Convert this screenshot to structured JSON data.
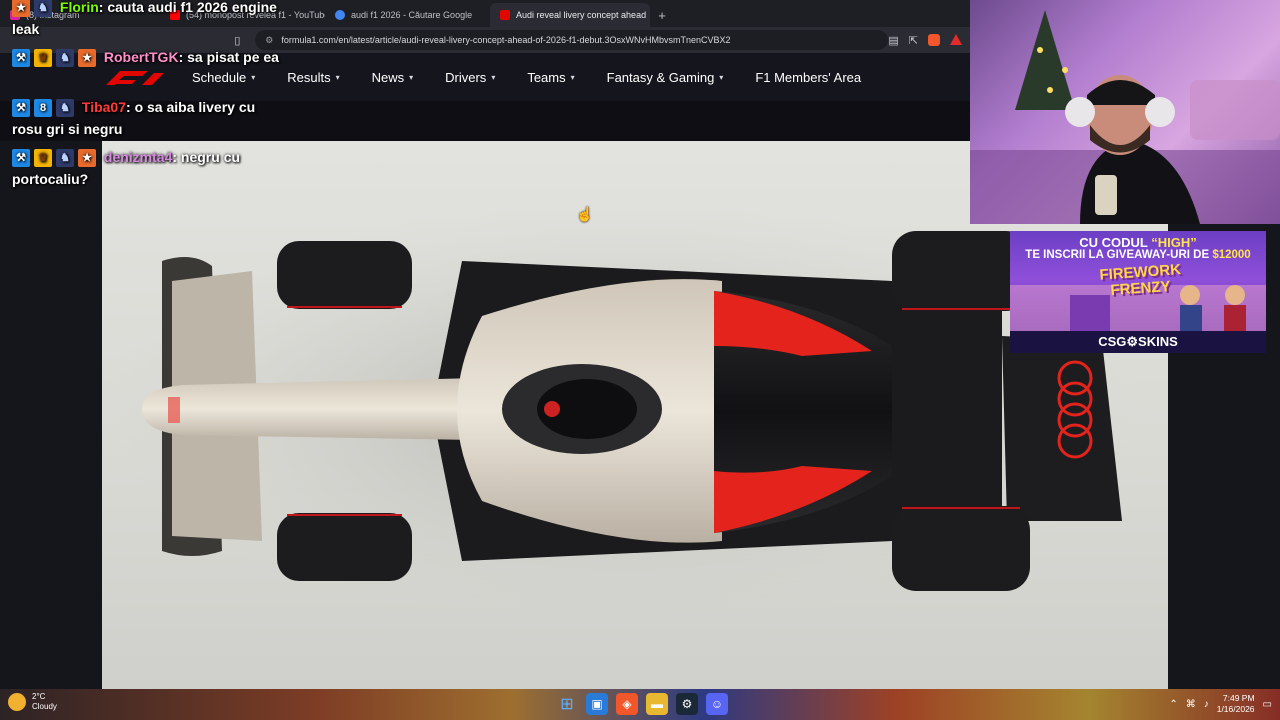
{
  "browser": {
    "tabs": [
      {
        "label": "(8) Instagram",
        "favicon_color": "#d6249f"
      },
      {
        "label": "(54) monopost revelea f1 - YouTube",
        "favicon_color": "#ff0000"
      },
      {
        "label": "audi f1 2026 - Căutare Google",
        "favicon_color": "#4285f4"
      },
      {
        "label": "Audi reveal livery concept ahead",
        "favicon_color": "#e10600",
        "active": true
      }
    ],
    "url": "formula1.com/en/latest/article/audi-reveal-livery-concept-ahead-of-2026-f1-debut.3OsxWNvHMbvsmTnenCVBX2"
  },
  "f1_nav": {
    "items": [
      "Schedule",
      "Results",
      "News",
      "Drivers",
      "Teams",
      "Fantasy & Gaming",
      "F1 Members' Area"
    ],
    "has_dropdown": [
      true,
      true,
      true,
      true,
      true,
      true,
      false
    ],
    "brand_color": "#e10600"
  },
  "chat": [
    {
      "user": "Florin",
      "user_color": "#7CFC00",
      "text": "cauta audi f1 2026 engine leak"
    },
    {
      "user": "RobertTGK",
      "user_color": "#ff8fc8",
      "text": "sa pisat pe ea"
    },
    {
      "user": "Tiba07",
      "user_color": "#ff3b3b",
      "text": "o sa aiba livery cu rosu gri si negru"
    },
    {
      "user": "denizmta4",
      "user_color": "#d58ae0",
      "text": "negru cu portocaliu?"
    }
  ],
  "ad": {
    "line1_prefix": "CU CODUL ",
    "line1_code": "“HIGH”",
    "line2_prefix": "TE INSCRII LA GIVEAWAY-URI DE ",
    "line2_amount": "$12000",
    "game_name": "FIREWORK FRENZY",
    "brand": "CSG⚙SKINS"
  },
  "taskbar": {
    "weather_temp": "2°C",
    "weather_desc": "Cloudy",
    "time": "7:49 PM",
    "date": "1/16/2026"
  }
}
